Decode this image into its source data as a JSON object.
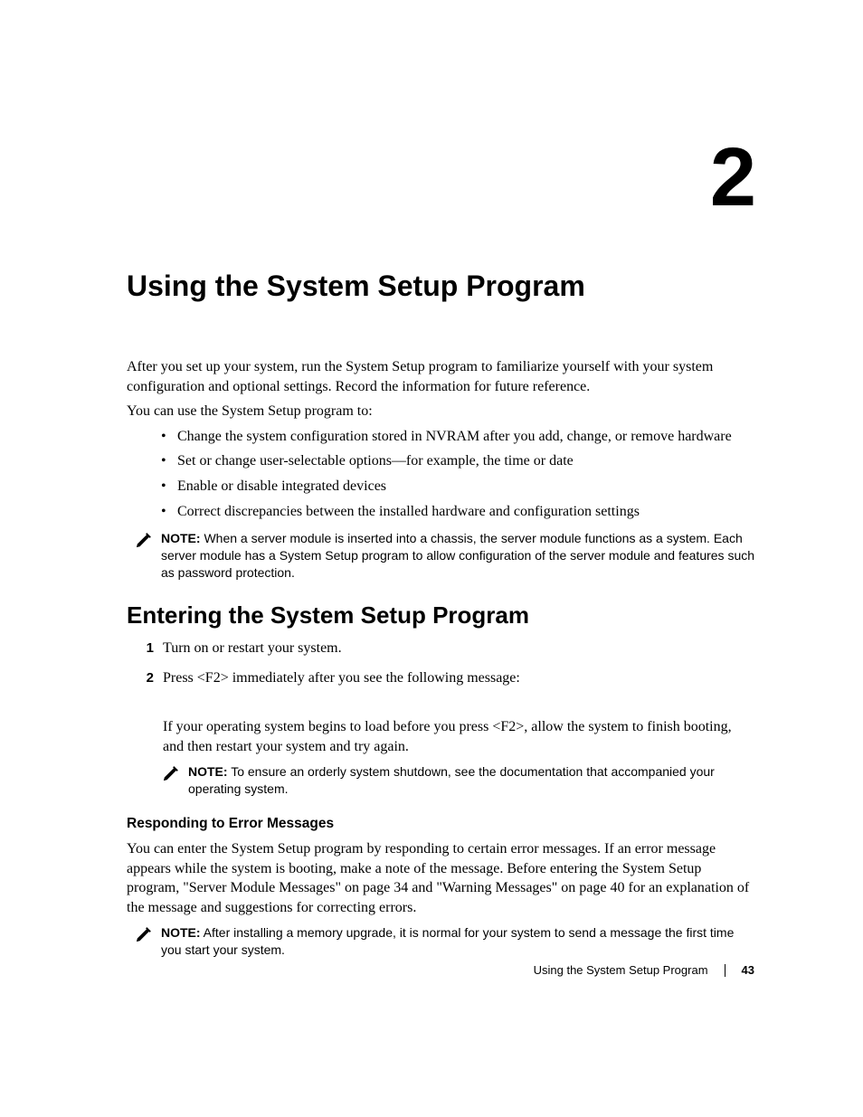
{
  "chapter": {
    "number": "2",
    "title": "Using the System Setup Program"
  },
  "intro": {
    "p1": "After you set up your system, run the System Setup program to familiarize yourself with your system configuration and optional settings. Record the information for future reference.",
    "p2": "You can use the System Setup program to:"
  },
  "bullets": [
    "Change the system configuration stored in NVRAM after you add, change, or remove hardware",
    "Set or change user-selectable options—for example, the time or date",
    "Enable or disable integrated devices",
    "Correct discrepancies between the installed hardware and configuration settings"
  ],
  "note1": {
    "label": "NOTE:",
    "text": " When a server module is inserted into a chassis, the server module functions as a system. Each server module has a System Setup program to allow configuration of the server module and features such as password protection."
  },
  "section1": {
    "heading": "Entering the System Setup Program",
    "steps": [
      {
        "num": "1",
        "text": "Turn on or restart your system."
      },
      {
        "num": "2",
        "text": "Press <F2> immediately after you see the following message:"
      }
    ],
    "followup": "If your operating system begins to load before you press <F2>, allow the system to finish booting, and then restart your system and try again."
  },
  "note2": {
    "label": "NOTE:",
    "text": " To ensure an orderly system shutdown, see the documentation that accompanied your operating system."
  },
  "subsection": {
    "heading": "Responding to Error Messages",
    "p1": "You can enter the System Setup program by responding to certain error messages. If an error message appears while the system is booting, make a note of the message. Before entering the System Setup program, \"Server Module Messages\" on page 34 and \"Warning Messages\" on page 40 for an explanation of the message and suggestions for correcting errors."
  },
  "note3": {
    "label": "NOTE:",
    "text": " After installing a memory upgrade, it is normal for your system to send a message the first time you start your system."
  },
  "footer": {
    "title": "Using the System Setup Program",
    "page": "43"
  }
}
